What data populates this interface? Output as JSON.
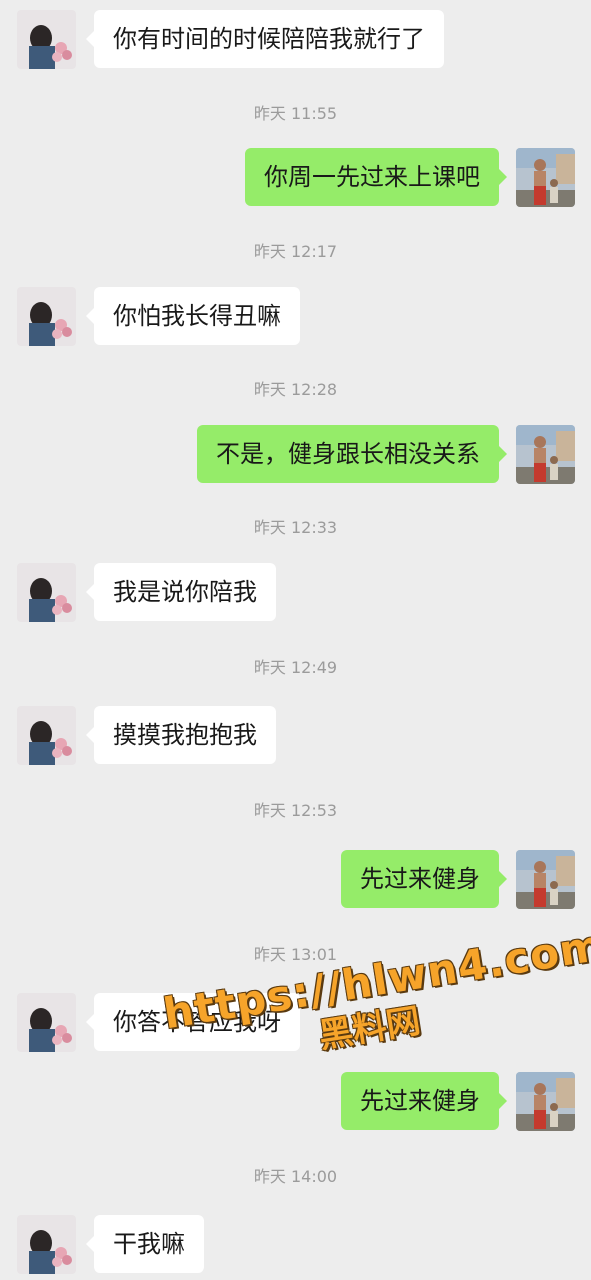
{
  "chat": {
    "messages": [
      {
        "type": "msg",
        "side": "left",
        "text": "你有时间的时候陪陪我就行了"
      },
      {
        "type": "time",
        "text": "昨天 11:55"
      },
      {
        "type": "msg",
        "side": "right",
        "text": "你周一先过来上课吧"
      },
      {
        "type": "time",
        "text": "昨天 12:17"
      },
      {
        "type": "msg",
        "side": "left",
        "text": "你怕我长得丑嘛"
      },
      {
        "type": "time",
        "text": "昨天 12:28"
      },
      {
        "type": "msg",
        "side": "right",
        "text": "不是，健身跟长相没关系"
      },
      {
        "type": "time",
        "text": "昨天 12:33"
      },
      {
        "type": "msg",
        "side": "left",
        "text": "我是说你陪我"
      },
      {
        "type": "time",
        "text": "昨天 12:49"
      },
      {
        "type": "msg",
        "side": "left",
        "text": "摸摸我抱抱我"
      },
      {
        "type": "time",
        "text": "昨天 12:53"
      },
      {
        "type": "msg",
        "side": "right",
        "text": "先过来健身"
      },
      {
        "type": "time",
        "text": "昨天 13:01"
      },
      {
        "type": "msg",
        "side": "left",
        "text": "你答不答应我呀"
      },
      {
        "type": "msg",
        "side": "right",
        "text": "先过来健身"
      },
      {
        "type": "time",
        "text": "昨天 14:00"
      },
      {
        "type": "msg",
        "side": "left",
        "text": "干我嘛"
      }
    ]
  },
  "watermark": {
    "url": "https://hlwn4.com",
    "name": "黑料网"
  },
  "colors": {
    "background": "#ededed",
    "incoming_bubble": "#ffffff",
    "outgoing_bubble": "#95ec69",
    "timestamp_text": "#9b9b9b",
    "watermark": "#f6a42a"
  },
  "icons": {
    "left_avatar": "girl-with-flowers-avatar",
    "right_avatar": "man-street-photo-avatar"
  }
}
